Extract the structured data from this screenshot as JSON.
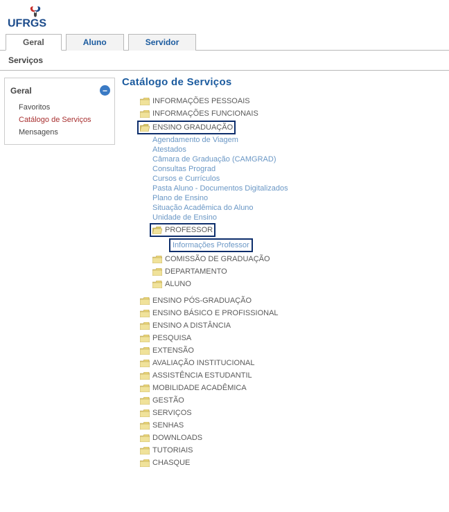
{
  "logo_text": "UFRGS",
  "tabs": {
    "t0": "Geral",
    "t1": "Aluno",
    "t2": "Servidor"
  },
  "subnav": "Serviços",
  "sidebar": {
    "title": "Geral",
    "items": {
      "i0": "Favoritos",
      "i1": "Catálogo de Serviços",
      "i2": "Mensagens"
    }
  },
  "catalog_title": "Catálogo de Serviços",
  "tree": {
    "info_pessoais": "INFORMAÇÕES PESSOAIS",
    "info_funcionais": "INFORMAÇÕES FUNCIONAIS",
    "ensino_grad": "ENSINO GRADUAÇÃO",
    "grad_children": {
      "c0": "Agendamento de Viagem",
      "c1": "Atestados",
      "c2": "Câmara de Graduação (CAMGRAD)",
      "c3": "Consultas Prograd",
      "c4": "Cursos e Currículos",
      "c5": "Pasta Aluno - Documentos Digitalizados",
      "c6": "Plano de Ensino",
      "c7": "Situação Acadêmica do Aluno",
      "c8": "Unidade de Ensino"
    },
    "professor": "PROFESSOR",
    "professor_child": "Informações Professor",
    "comissao": "COMISSÃO DE GRADUAÇÃO",
    "departamento": "DEPARTAMENTO",
    "aluno": "ALUNO",
    "rest": {
      "r0": "ENSINO PÓS-GRADUAÇÃO",
      "r1": "ENSINO BÁSICO E PROFISSIONAL",
      "r2": "ENSINO A DISTÂNCIA",
      "r3": "PESQUISA",
      "r4": "EXTENSÃO",
      "r5": "AVALIAÇÃO INSTITUCIONAL",
      "r6": "ASSISTÊNCIA ESTUDANTIL",
      "r7": "MOBILIDADE ACADÊMICA",
      "r8": "GESTÃO",
      "r9": "SERVIÇOS",
      "r10": "SENHAS",
      "r11": "DOWNLOADS",
      "r12": "TUTORIAIS",
      "r13": "CHASQUE"
    }
  }
}
